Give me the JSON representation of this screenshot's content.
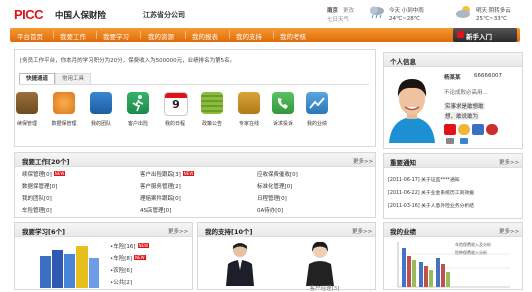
{
  "header": {
    "logo": "PICC",
    "company": "中国人保财险",
    "branch": "江苏省分公司",
    "weather": {
      "city": "南京",
      "change_link": "更改",
      "forecast_label": "七日天气",
      "today_label": "今天 小到中雨",
      "today_temp": "24℃~28℃",
      "tomorrow_label": "明天 阴转多云",
      "tomorrow_temp": "25℃~33℃"
    }
  },
  "nav": {
    "items": [
      "平台首页",
      "我要工作",
      "我要学习",
      "我的资源",
      "我的报表",
      "我的支持",
      "我的考核"
    ],
    "help": "新手入门"
  },
  "announcement": "[务员工作平台，你本月的学习积分为20分，保费收入为500000元，业绩排名为第5名。",
  "quick": {
    "tabs": [
      "快捷通道",
      "常用工具"
    ],
    "items": [
      "续保管理",
      "数据保管理",
      "我的团队",
      "客户出险",
      "我的日程",
      "政策公告",
      "专家在线",
      "诉求投诉",
      "我的业绩"
    ],
    "calendar_day": "9"
  },
  "work": {
    "title": "我要工作[20个]",
    "more": "更多>>",
    "rows": [
      [
        "续保管理[0]",
        "客户出险跟踪[3]",
        "应收保费催收[0]"
      ],
      [
        "数据保管理[0]",
        "客户服务管理[2]",
        "标准化管理[0]"
      ],
      [
        "我的团队[0]",
        "理赔案件跟踪[0]",
        "日程管理[0]"
      ],
      [
        "车险管理[0]",
        "4S店管理[0]",
        "0A待办[0]"
      ]
    ]
  },
  "study": {
    "title": "我要学习[6个]",
    "more": "更多>>",
    "items": [
      "车险[16]",
      "车险[8]",
      "农险[6]",
      "公共[2]"
    ]
  },
  "support": {
    "title": "我的支持[10个]",
    "more": "更多>>",
    "caption": "..客户经理[3]"
  },
  "personal": {
    "title": "个人信息",
    "name": "杨某某",
    "id": "66666007",
    "status": "不论成败必高用...",
    "motto1": "实事求是敢想敢",
    "motto2": "想，敢说敢为"
  },
  "notice": {
    "title": "重要通知",
    "more": "更多>>",
    "items": [
      {
        "date": "[2011-06-17]",
        "text": "关于证监****通知"
      },
      {
        "date": "[2011-06-22]",
        "text": "关于业金系统历工资效据"
      },
      {
        "date": "[2011-03-16]",
        "text": "关于人意外险业务分析结"
      }
    ]
  },
  "performance": {
    "title": "我的业绩",
    "more": "更多>>",
    "legend": [
      "车险保费收入及分析",
      "险种保费收入分析"
    ]
  },
  "colors": {
    "accent": "#e0131a",
    "nav": "#ee7f1a",
    "help": "#333333"
  }
}
